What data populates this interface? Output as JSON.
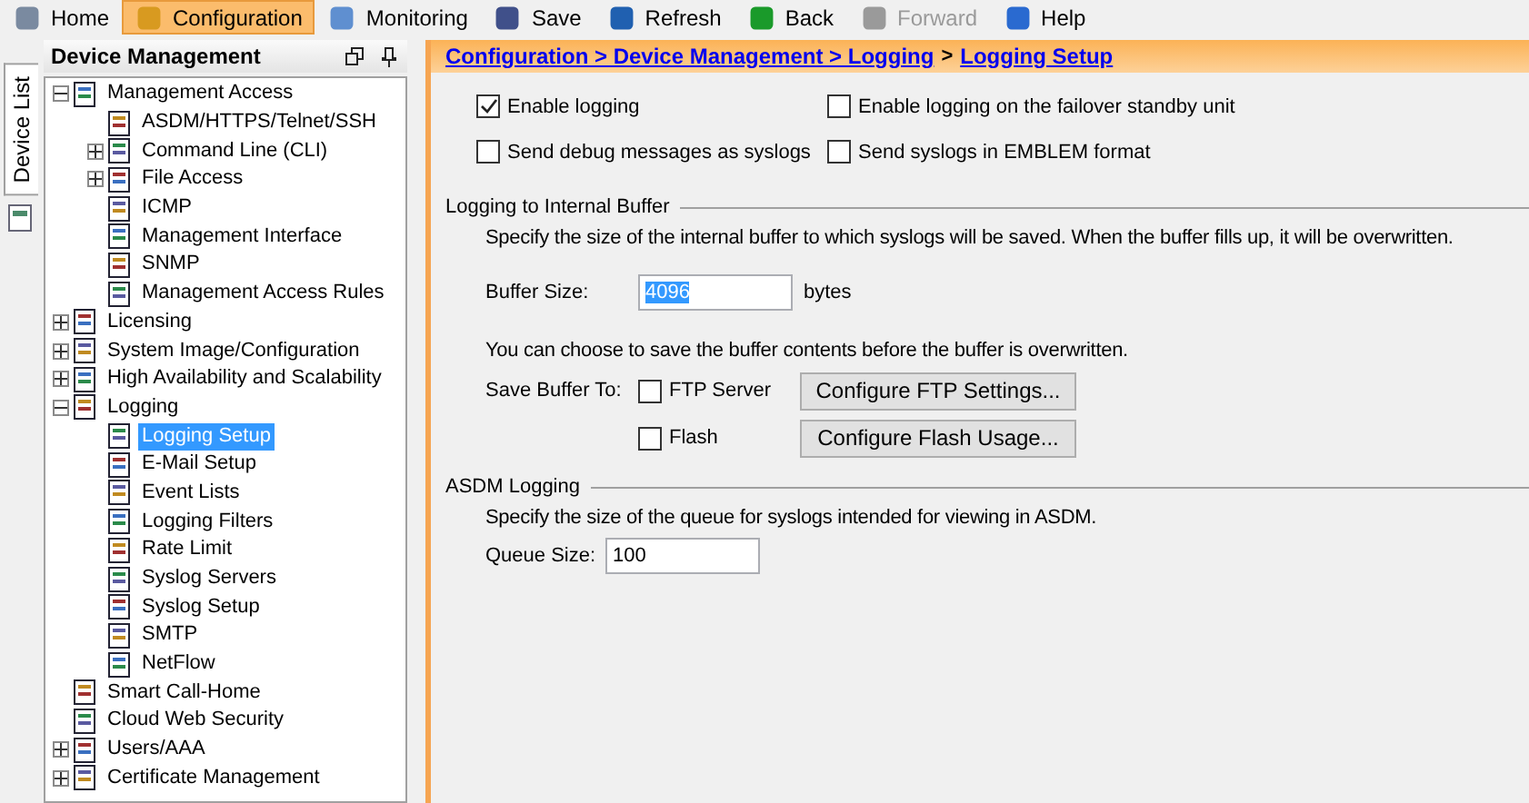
{
  "toolbar": [
    {
      "label": "Home",
      "selected": false,
      "disabled": false
    },
    {
      "label": "Configuration",
      "selected": true,
      "disabled": false
    },
    {
      "label": "Monitoring",
      "selected": false,
      "disabled": false
    },
    {
      "label": "Save",
      "selected": false,
      "disabled": false
    },
    {
      "label": "Refresh",
      "selected": false,
      "disabled": false
    },
    {
      "label": "Back",
      "selected": false,
      "disabled": false
    },
    {
      "label": "Forward",
      "selected": false,
      "disabled": true
    },
    {
      "label": "Help",
      "selected": false,
      "disabled": false
    }
  ],
  "side_tab": {
    "label": "Device List"
  },
  "panel": {
    "title": "Device Management",
    "tree": [
      {
        "label": "Management Access",
        "selected": false,
        "expanded": true,
        "children": [
          {
            "label": "ASDM/HTTPS/Telnet/SSH",
            "selected": false
          },
          {
            "label": "Command Line (CLI)",
            "selected": false,
            "expanded": false
          },
          {
            "label": "File Access",
            "selected": false,
            "expanded": false
          },
          {
            "label": "ICMP",
            "selected": false
          },
          {
            "label": "Management Interface",
            "selected": false
          },
          {
            "label": "SNMP",
            "selected": false
          },
          {
            "label": "Management Access Rules",
            "selected": false
          }
        ]
      },
      {
        "label": "Licensing",
        "selected": false,
        "expanded": false
      },
      {
        "label": "System Image/Configuration",
        "selected": false,
        "expanded": false
      },
      {
        "label": "High Availability and Scalability",
        "selected": false,
        "expanded": false
      },
      {
        "label": "Logging",
        "selected": false,
        "expanded": true,
        "children": [
          {
            "label": "Logging Setup",
            "selected": true
          },
          {
            "label": "E-Mail Setup",
            "selected": false
          },
          {
            "label": "Event Lists",
            "selected": false
          },
          {
            "label": "Logging Filters",
            "selected": false
          },
          {
            "label": "Rate Limit",
            "selected": false
          },
          {
            "label": "Syslog Servers",
            "selected": false
          },
          {
            "label": "Syslog Setup",
            "selected": false
          },
          {
            "label": "SMTP",
            "selected": false
          },
          {
            "label": "NetFlow",
            "selected": false
          }
        ]
      },
      {
        "label": "Smart Call-Home",
        "selected": false
      },
      {
        "label": "Cloud Web Security",
        "selected": false
      },
      {
        "label": "Users/AAA",
        "selected": false,
        "expanded": false
      },
      {
        "label": "Certificate Management",
        "selected": false,
        "expanded": false
      }
    ]
  },
  "breadcrumb": [
    {
      "text": "Configuration > Device Management > Logging",
      "kind": "link"
    },
    {
      "text": ">",
      "kind": "separator"
    },
    {
      "text": "Logging Setup",
      "kind": "link"
    }
  ],
  "options": [
    {
      "label": "Enable logging",
      "checked": true
    },
    {
      "label": "Enable logging on the failover standby unit",
      "checked": false
    },
    {
      "label": "Send debug messages as syslogs",
      "checked": false
    },
    {
      "label": "Send syslogs in EMBLEM format",
      "checked": false
    }
  ],
  "internal_buffer": {
    "title": "Logging to Internal Buffer",
    "description": "Specify the size of the internal buffer to which syslogs will be saved. When the buffer fills up, it will be overwritten.",
    "buffer_size": {
      "label": "Buffer Size:",
      "value": "4096",
      "highlighted": true,
      "unit": "bytes"
    },
    "save_note": "You can choose to save the buffer contents before the buffer is overwritten.",
    "save_label": "Save Buffer To:",
    "targets": [
      {
        "label": "FTP Server",
        "checked": false,
        "button": "Configure FTP Settings..."
      },
      {
        "label": "Flash",
        "checked": false,
        "button": "Configure Flash Usage..."
      }
    ]
  },
  "asdm_logging": {
    "title": "ASDM Logging",
    "description": "Specify the size of the queue for syslogs intended for viewing in ASDM.",
    "queue_size": {
      "label": "Queue Size:",
      "value": "100"
    }
  }
}
